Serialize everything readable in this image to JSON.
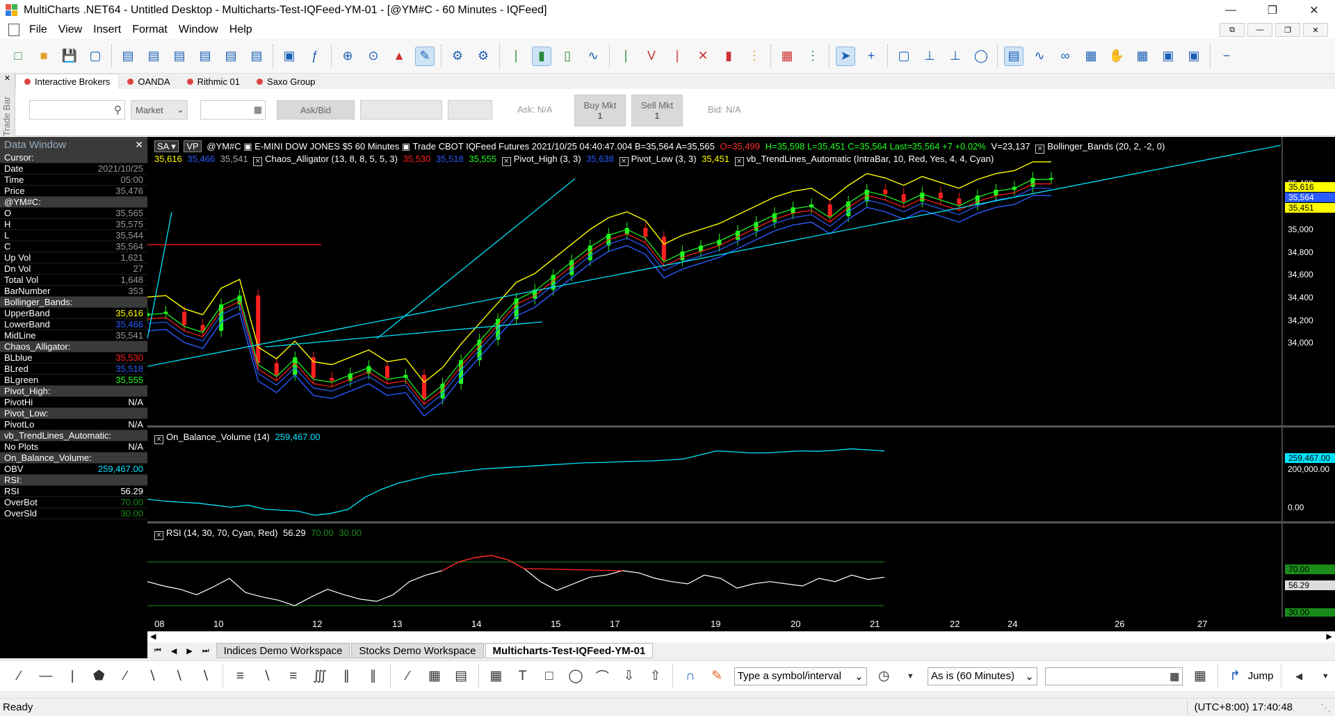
{
  "window": {
    "title": "MultiCharts .NET64 - Untitled Desktop - Multicharts-Test-IQFeed-YM-01 - [@YM#C - 60 Minutes - IQFeed]"
  },
  "menu": [
    "File",
    "View",
    "Insert",
    "Format",
    "Window",
    "Help"
  ],
  "trade_bar": {
    "side_label": "Trade Bar",
    "brokers": [
      "Interactive Brokers",
      "OANDA",
      "Rithmic 01",
      "Saxo Group"
    ],
    "order_type": "Market",
    "askbid_label": "Ask/Bid",
    "ask_label": "Ask: N/A",
    "bid_label": "Bid: N/A",
    "buy_label": "Buy Mkt",
    "buy_qty": "1",
    "sell_label": "Sell Mkt",
    "sell_qty": "1"
  },
  "data_window": {
    "title": "Data Window",
    "rows": [
      {
        "k": "Cursor:",
        "v": "",
        "hdr": true
      },
      {
        "k": "Date",
        "v": "2021/10/25"
      },
      {
        "k": "Time",
        "v": "05:00"
      },
      {
        "k": "Price",
        "v": "35,476"
      },
      {
        "k": "@YM#C:",
        "v": "",
        "hdr": true
      },
      {
        "k": "O",
        "v": "35,565"
      },
      {
        "k": "H",
        "v": "35,575"
      },
      {
        "k": "L",
        "v": "35,544"
      },
      {
        "k": "C",
        "v": "35,564"
      },
      {
        "k": "Up Vol",
        "v": "1,621"
      },
      {
        "k": "Dn Vol",
        "v": "27"
      },
      {
        "k": "Total Vol",
        "v": "1,648"
      },
      {
        "k": "BarNumber",
        "v": "353"
      },
      {
        "k": "Bollinger_Bands:",
        "v": "",
        "hdr": true
      },
      {
        "k": "UpperBand",
        "v": "35,616",
        "c": "#ffff00"
      },
      {
        "k": "LowerBand",
        "v": "35,466",
        "c": "#2a5cff"
      },
      {
        "k": "MidLine",
        "v": "35,541"
      },
      {
        "k": "Chaos_Alligator:",
        "v": "",
        "hdr": true
      },
      {
        "k": "BLblue",
        "v": "35,530",
        "c": "#ff2020"
      },
      {
        "k": "BLred",
        "v": "35,518",
        "c": "#2a5cff"
      },
      {
        "k": "BLgreen",
        "v": "35,555",
        "c": "#20ff20"
      },
      {
        "k": "Pivot_High:",
        "v": "",
        "hdr": true
      },
      {
        "k": "PivotHi",
        "v": "N/A",
        "c": "#ffffff"
      },
      {
        "k": "Pivot_Low:",
        "v": "",
        "hdr": true
      },
      {
        "k": "PivotLo",
        "v": "N/A",
        "c": "#ffffff"
      },
      {
        "k": "vb_TrendLines_Automatic:",
        "v": "",
        "hdr": true
      },
      {
        "k": "No Plots",
        "v": "N/A",
        "c": "#ffffff"
      },
      {
        "k": "On_Balance_Volume:",
        "v": "",
        "hdr": true
      },
      {
        "k": "OBV",
        "v": "259,467.00",
        "c": "#00e5ff"
      },
      {
        "k": "RSI:",
        "v": "",
        "hdr": true
      },
      {
        "k": "RSI",
        "v": "56.29",
        "c": "#ffffff"
      },
      {
        "k": "OverBot",
        "v": "70.00",
        "c": "#1a8c1a"
      },
      {
        "k": "OverSld",
        "v": "30.00",
        "c": "#1a8c1a"
      }
    ]
  },
  "chart": {
    "status_line": "@YM#C  ▣ E-MINI DOW JONES $5  60 Minutes  ▣ Trade  CBOT  IQFeed  Futures  2021/10/25  04:40:47.004  B=35,564  A=35,565",
    "o": "O=35,499",
    "hlc": "H=35,598  L=35,451  C=35,564  Last=35,564  +7  +0.02%",
    "v": "V=23,137",
    "bb_legend": "Bollinger_Bands   (20,  2,  -2,  0)",
    "bb_upper": "35,616",
    "bb_lower": "35,466",
    "bb_mid": "35,541",
    "alligator_legend": "Chaos_Alligator   (13,  8,  8,  5,  5,  3)",
    "al_blue": "35,530",
    "al_red": "35,518",
    "al_green": "35,555",
    "pivot_high_legend": "Pivot_High   (3,  3)",
    "pivot_high_val": "35,638",
    "pivot_low_legend": "Pivot_Low   (3,  3)",
    "pivot_low_val": "35,451",
    "trend_legend": "vb_TrendLines_Automatic   (IntraBar,  10,  Red,  Yes,  4,  4,  Cyan)",
    "price_ticks": [
      "35,400",
      "35,200",
      "35,000",
      "34,800",
      "34,600",
      "34,400",
      "34,200",
      "34,000"
    ],
    "price_tags": [
      "35,616",
      "35,564",
      "35,451"
    ],
    "obv_legend": "On_Balance_Volume   (14)",
    "obv_val": "259,467.00",
    "obv_ticks": [
      "200,000.00",
      "0.00"
    ],
    "rsi_legend": "RSI   (14,  30,  70,  Cyan,  Red)",
    "rsi_val": "56.29",
    "rsi_ob": "70.00",
    "rsi_os": "30.00",
    "rsi_tags": [
      "70.00",
      "56.29",
      "30.00"
    ],
    "x_ticks": [
      "08",
      "10",
      "12",
      "13",
      "14",
      "15",
      "17",
      "19",
      "20",
      "21",
      "22",
      "24",
      "26",
      "27"
    ]
  },
  "workspaces": [
    "Indices Demo Workspace",
    "Stocks Demo Workspace",
    "Multicharts-Test-IQFeed-YM-01"
  ],
  "drawing_bar": {
    "symbol_placeholder": "Type a symbol/interval",
    "interval": "As is (60 Minutes)",
    "jump_label": "Jump"
  },
  "status": {
    "text": "Ready",
    "clock": "(UTC+8:00) 17:40:48"
  },
  "chart_data": {
    "type": "line",
    "series": [
      {
        "name": "@YM#C",
        "values": [
          34640,
          34650,
          34560,
          34520,
          34700,
          34760,
          34300,
          34220,
          34340,
          34200,
          34180,
          34230,
          34280,
          34200,
          34220,
          34060,
          34160,
          34320,
          34460,
          34600,
          34740,
          34800,
          34900,
          35000,
          35100,
          35180,
          35220,
          35160,
          35000,
          35060,
          35100,
          35140,
          35200,
          35260,
          35320,
          35360,
          35380,
          35300,
          35400,
          35480,
          35450,
          35400,
          35460,
          35420,
          35380,
          35440,
          35480,
          35500,
          35560,
          35560
        ]
      },
      {
        "name": "On_Balance_Volume",
        "values": [
          20000,
          10000,
          5000,
          0,
          -10000,
          -20000,
          -10000,
          -30000,
          -35000,
          -40000,
          -60000,
          -50000,
          -30000,
          30000,
          70000,
          100000,
          120000,
          140000,
          150000,
          160000,
          170000,
          175000,
          180000,
          185000,
          190000,
          195000,
          200000,
          202000,
          205000,
          208000,
          210000,
          214000,
          220000,
          240000,
          260000,
          255000,
          250000,
          250000,
          255000,
          260000,
          258000,
          262000,
          270000,
          265000,
          259467
        ]
      },
      {
        "name": "RSI",
        "values": [
          52,
          48,
          45,
          40,
          47,
          55,
          42,
          38,
          35,
          30,
          38,
          45,
          40,
          36,
          34,
          40,
          52,
          58,
          62,
          70,
          74,
          76,
          72,
          64,
          52,
          44,
          50,
          56,
          58,
          62,
          60,
          55,
          52,
          50,
          58,
          55,
          46,
          50,
          52,
          50,
          48,
          55,
          52,
          58,
          54,
          56
        ]
      }
    ],
    "x": [
      "08",
      "10",
      "12",
      "13",
      "14",
      "15",
      "17",
      "19",
      "20",
      "21",
      "22",
      "24",
      "26",
      "27"
    ],
    "ylim": [
      33900,
      35650
    ]
  }
}
